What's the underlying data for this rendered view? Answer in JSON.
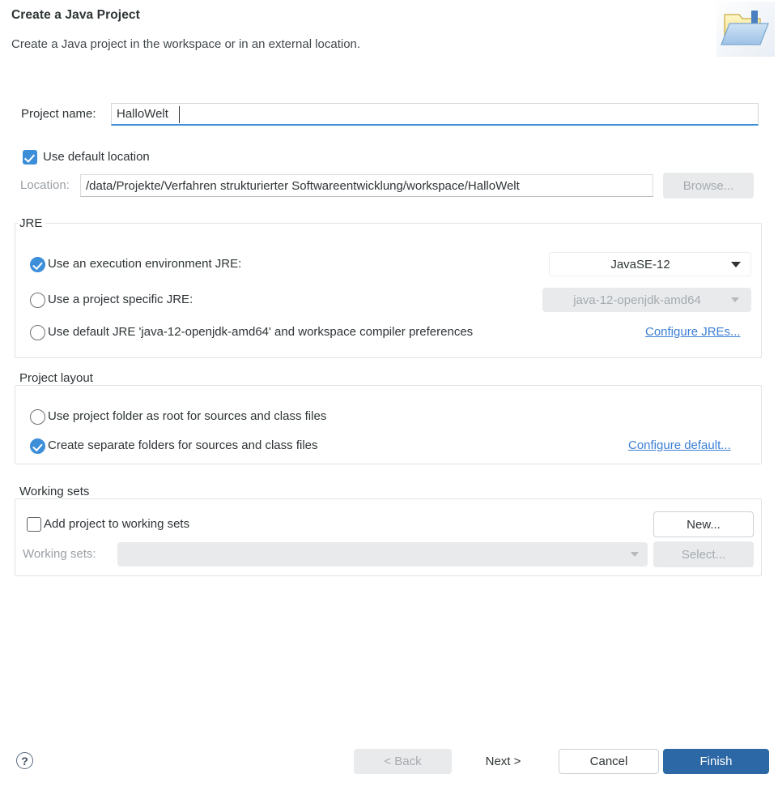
{
  "header": {
    "title": "Create a Java Project",
    "description": "Create a Java project in the workspace or in an external location.",
    "icon": "java-project-folder-icon"
  },
  "project_name": {
    "label": "Project name:",
    "value": "HalloWelt",
    "placeholder": ""
  },
  "default_location": {
    "label": "Use default location",
    "checked": true
  },
  "location": {
    "label": "Location:",
    "value": "/data/Projekte/Verfahren strukturierter Softwareentwicklung/workspace/HalloWelt",
    "browse_label": "Browse...",
    "browse_enabled": false
  },
  "jre": {
    "group_title": "JRE",
    "options": [
      {
        "label": "Use an execution environment JRE:",
        "selected": true,
        "combo_value": "JavaSE-12",
        "combo_enabled": true
      },
      {
        "label": "Use a project specific JRE:",
        "selected": false,
        "combo_value": "java-12-openjdk-amd64",
        "combo_enabled": false
      },
      {
        "label": "Use default JRE 'java-12-openjdk-amd64' and workspace compiler preferences",
        "selected": false
      }
    ],
    "configure_link": "Configure JREs..."
  },
  "project_layout": {
    "group_title": "Project layout",
    "options": [
      {
        "label": "Use project folder as root for sources and class files",
        "selected": false
      },
      {
        "label": "Create separate folders for sources and class files",
        "selected": true
      }
    ],
    "configure_link": "Configure default..."
  },
  "working_sets": {
    "group_title": "Working sets",
    "add_label": "Add project to working sets",
    "add_checked": false,
    "sets_label": "Working sets:",
    "sets_value": "",
    "new_label": "New...",
    "new_enabled": true,
    "select_label": "Select...",
    "select_enabled": false
  },
  "footer": {
    "help_glyph": "?",
    "back_label": "< Back",
    "back_enabled": false,
    "next_label": "Next >",
    "next_enabled": true,
    "cancel_label": "Cancel",
    "cancel_enabled": true,
    "finish_label": "Finish",
    "finish_enabled": true
  },
  "colors": {
    "accent_blue": "#3d8ed9",
    "primary_button": "#2b68a5",
    "link_blue": "#3b7fd4",
    "disabled_bg": "#e8eaec",
    "text": "#2e3436"
  }
}
